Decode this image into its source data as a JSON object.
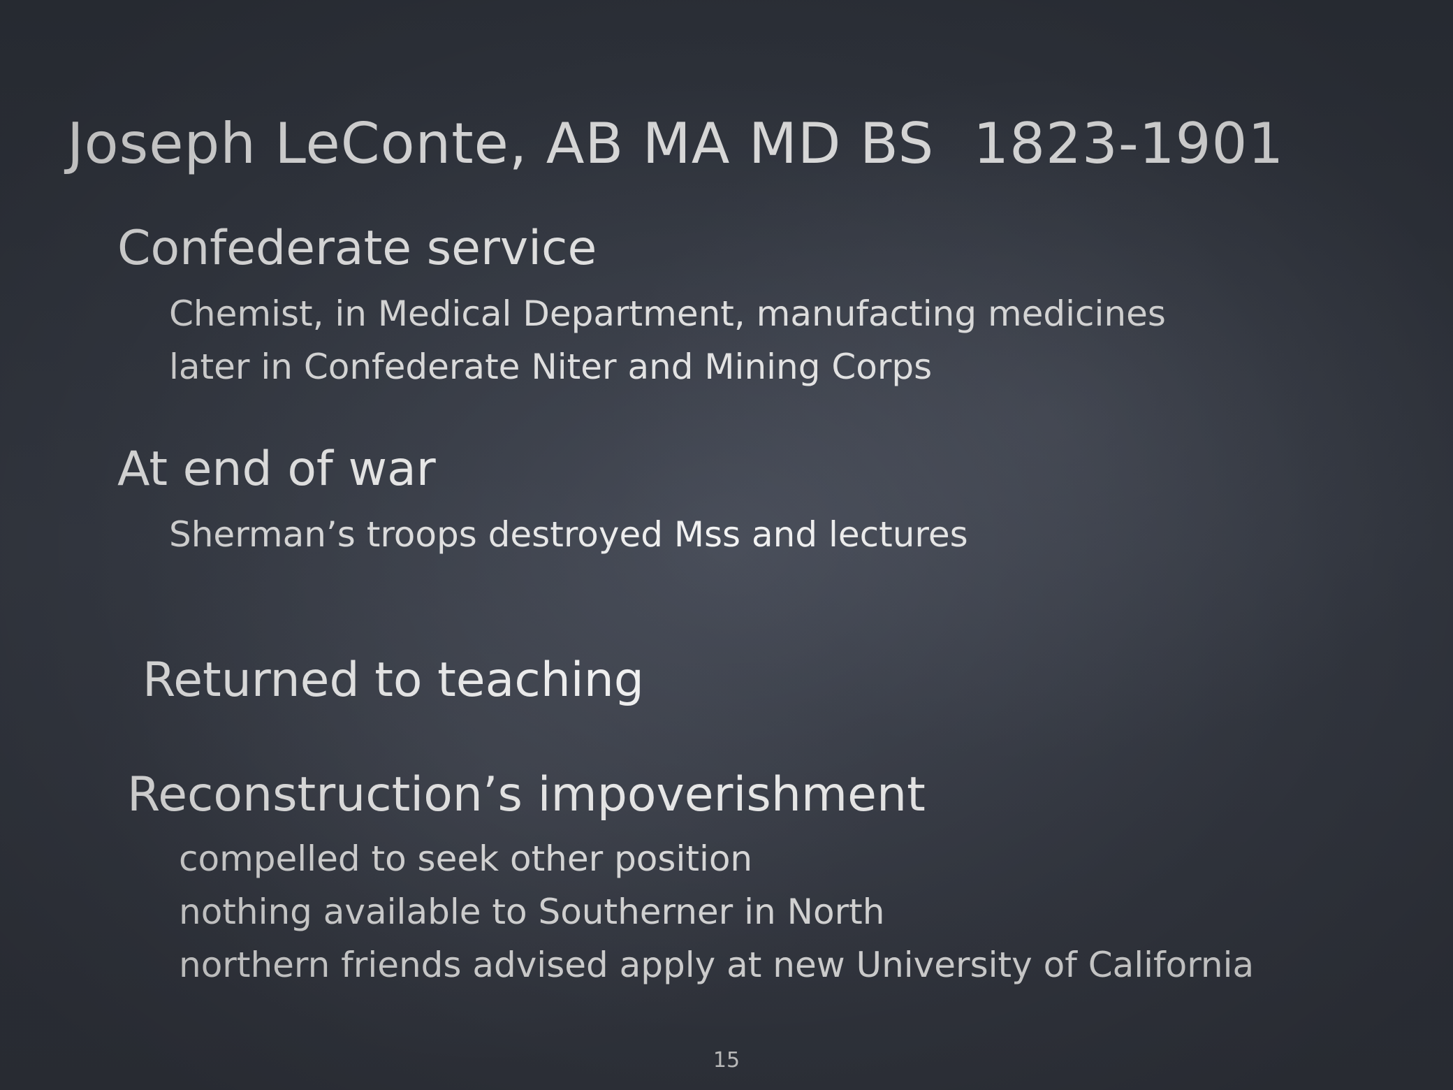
{
  "slide": {
    "title": {
      "name": "Joseph LeConte, AB MA MD BS",
      "dates": "1823-1901"
    },
    "sections": [
      {
        "heading": "Confederate service",
        "bullets": [
          "Chemist, in Medical Department, manufacting medicines",
          "later in Confederate Niter and Mining Corps"
        ]
      },
      {
        "heading": "At end of war",
        "bullets": [
          "Sherman’s troops destroyed Mss and lectures"
        ]
      },
      {
        "heading": "Returned to teaching",
        "bullets": []
      },
      {
        "heading": "Reconstruction’s impoverishment",
        "bullets": [
          "compelled to seek other position",
          "nothing available to Southerner in North",
          "northern friends advised apply at new University of California"
        ]
      }
    ],
    "page_number": "15"
  }
}
